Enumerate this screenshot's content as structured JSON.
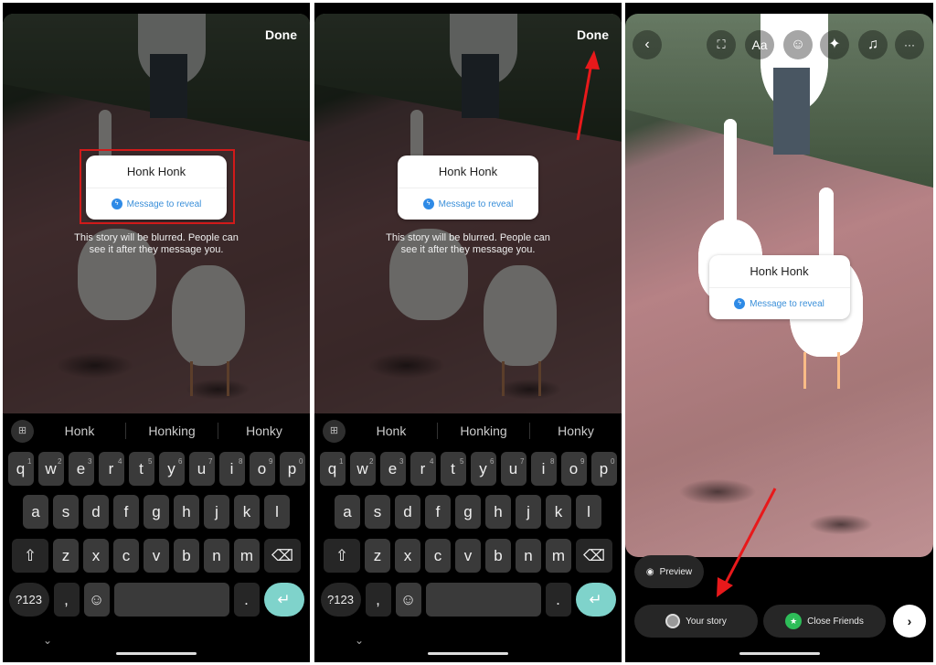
{
  "panels": [
    {
      "done_label": "Done",
      "sticker": {
        "question": "Honk Honk",
        "reveal": "Message to reveal"
      },
      "hint": "This story will be blurred. People can see it after they message you."
    },
    {
      "done_label": "Done",
      "sticker": {
        "question": "Honk Honk",
        "reveal": "Message to reveal"
      },
      "hint": "This story will be blurred. People can see it after they message you."
    },
    {
      "sticker": {
        "question": "Honk Honk",
        "reveal": "Message to reveal"
      },
      "toolbar": {
        "back": "‹",
        "expand": "⛶",
        "text": "Aa",
        "sticker": "☺",
        "effects": "✦",
        "music": "♫",
        "more": "···"
      },
      "preview_label": "Preview",
      "your_story_label": "Your story",
      "close_friends_label": "Close Friends",
      "next_icon": "›"
    }
  ],
  "keyboard": {
    "suggestions": [
      "Honk",
      "Honking",
      "Honky"
    ],
    "row1": [
      "q",
      "w",
      "e",
      "r",
      "t",
      "y",
      "u",
      "i",
      "o",
      "p"
    ],
    "row1_nums": [
      "1",
      "2",
      "3",
      "4",
      "5",
      "6",
      "7",
      "8",
      "9",
      "0"
    ],
    "row2": [
      "a",
      "s",
      "d",
      "f",
      "g",
      "h",
      "j",
      "k",
      "l"
    ],
    "row3": [
      "z",
      "x",
      "c",
      "v",
      "b",
      "n",
      "m"
    ],
    "symbols_label": "?123",
    "comma": ",",
    "period": ".",
    "shift": "⇧",
    "backspace": "⌫",
    "emoji": "☺",
    "enter": "↵",
    "grid": "⊞",
    "hide": "⌄"
  },
  "annotation_color": "#e8191b"
}
